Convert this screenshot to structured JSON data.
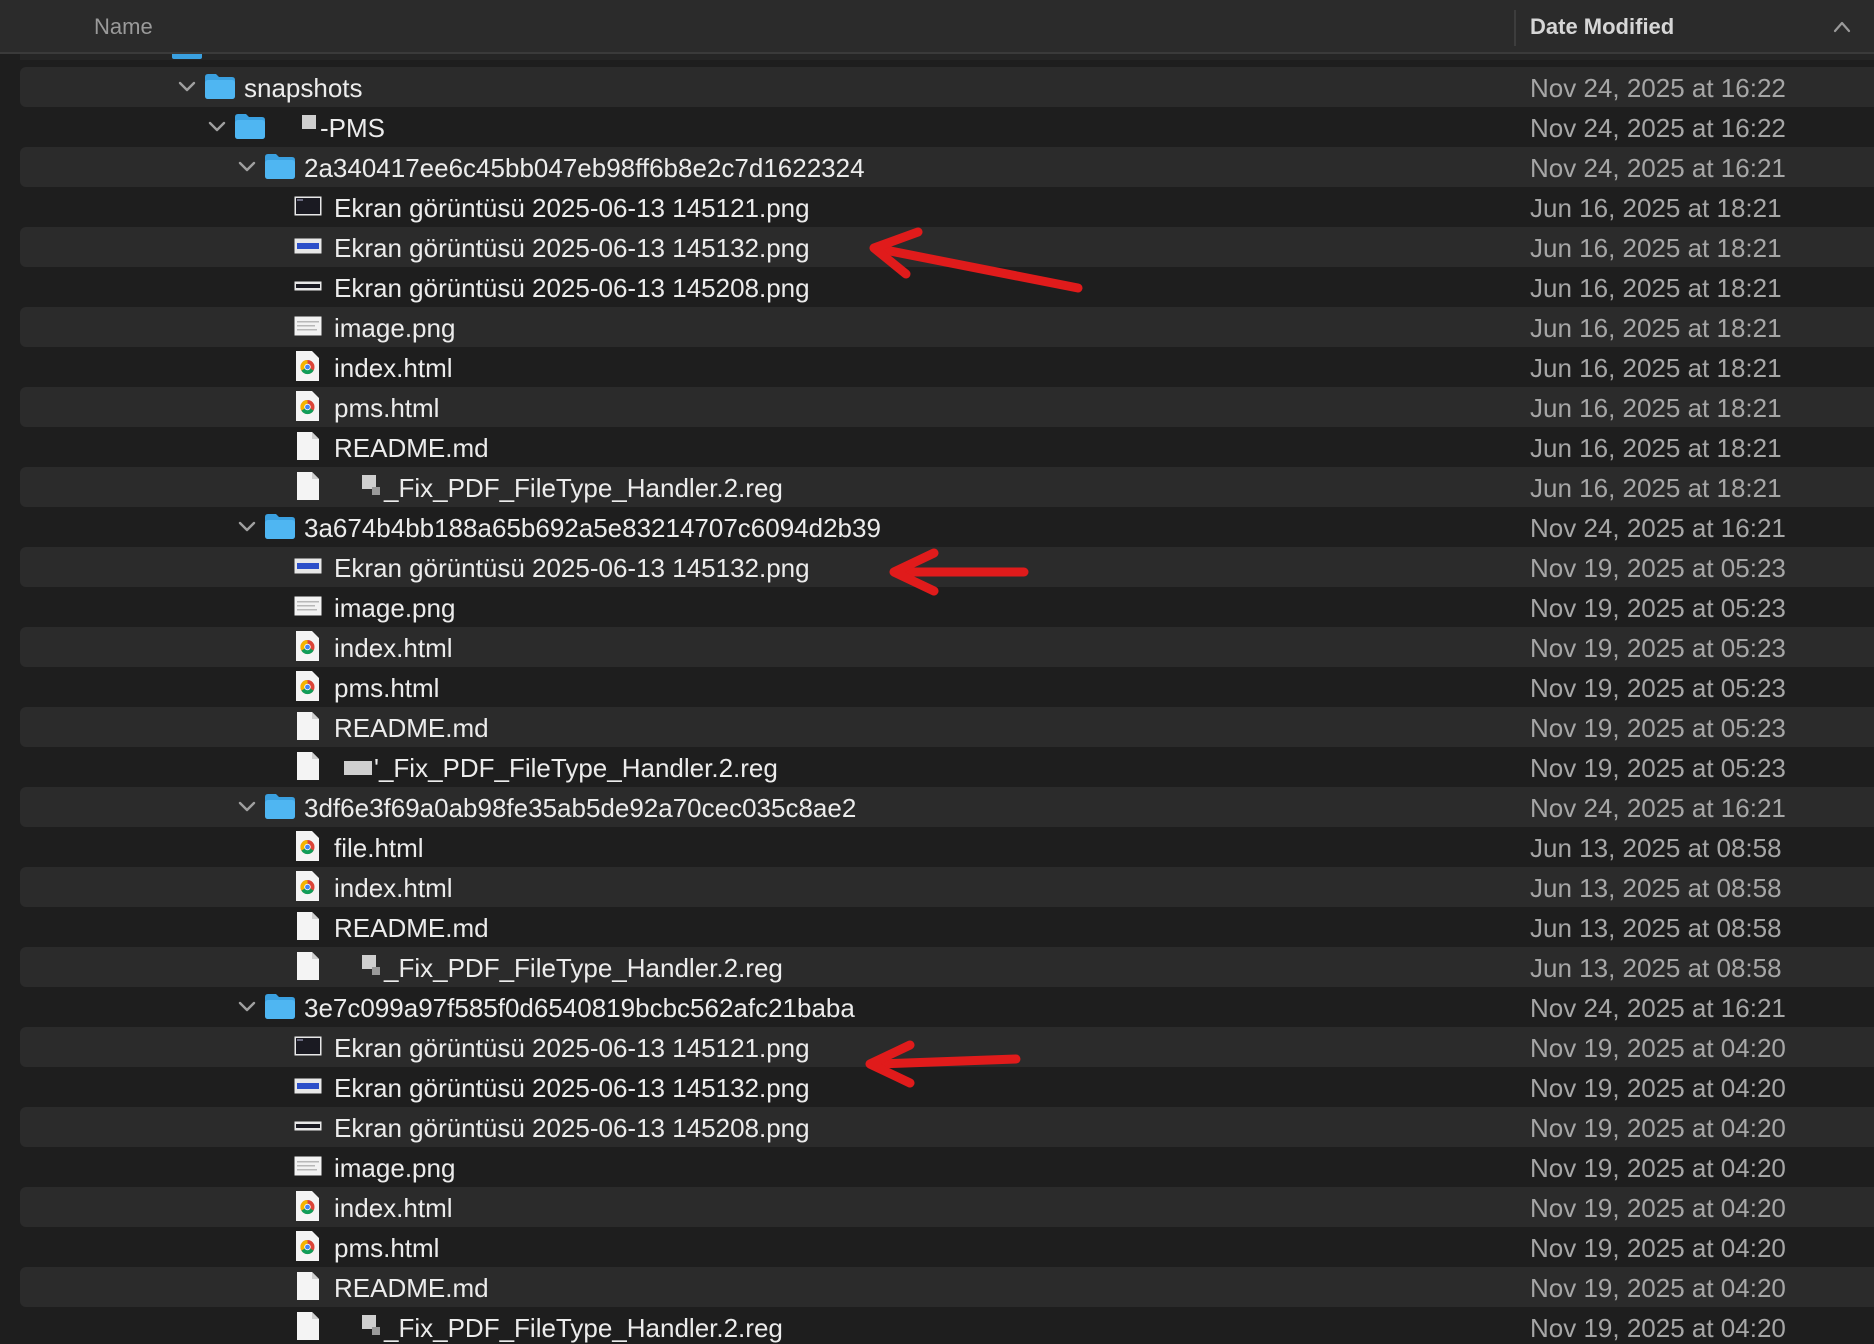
{
  "header": {
    "name_label": "Name",
    "date_label": "Date Modified"
  },
  "colors": {
    "background": "#1e1e1e",
    "row_alt": "#2b2b2b",
    "folder": "#3aa0e0",
    "annotation_arrow": "#e01b1b"
  },
  "rows": [
    {
      "name": "snapshots",
      "date": "Nov 24, 2025 at 16:22",
      "kind": "folder",
      "expanded": true
    },
    {
      "name": "-PMS",
      "date": "Nov 24, 2025 at 16:22",
      "kind": "folder",
      "expanded": true
    },
    {
      "name": "2a340417ee6c45bb047eb98ff6b8e2c7d1622324",
      "date": "Nov 24, 2025 at 16:21",
      "kind": "folder",
      "expanded": true
    },
    {
      "name": "Ekran görüntüsü 2025-06-13 145121.png",
      "date": "Jun 16, 2025 at 18:21",
      "kind": "png-screenshot"
    },
    {
      "name": "Ekran görüntüsü 2025-06-13 145132.png",
      "date": "Jun 16, 2025 at 18:21",
      "kind": "png-blue",
      "annotated": true
    },
    {
      "name": "Ekran görüntüsü 2025-06-13 145208.png",
      "date": "Jun 16, 2025 at 18:21",
      "kind": "png-wide"
    },
    {
      "name": "image.png",
      "date": "Jun 16, 2025 at 18:21",
      "kind": "png-image"
    },
    {
      "name": "index.html",
      "date": "Jun 16, 2025 at 18:21",
      "kind": "html"
    },
    {
      "name": "pms.html",
      "date": "Jun 16, 2025 at 18:21",
      "kind": "html"
    },
    {
      "name": "README.md",
      "date": "Jun 16, 2025 at 18:21",
      "kind": "document"
    },
    {
      "name": "_Fix_PDF_FileType_Handler.2.reg",
      "date": "Jun 16, 2025 at 18:21",
      "kind": "document"
    },
    {
      "name": "3a674b4bb188a65b692a5e83214707c6094d2b39",
      "date": "Nov 24, 2025 at 16:21",
      "kind": "folder",
      "expanded": true
    },
    {
      "name": "Ekran görüntüsü 2025-06-13 145132.png",
      "date": "Nov 19, 2025 at 05:23",
      "kind": "png-blue",
      "annotated": true
    },
    {
      "name": "image.png",
      "date": "Nov 19, 2025 at 05:23",
      "kind": "png-image"
    },
    {
      "name": "index.html",
      "date": "Nov 19, 2025 at 05:23",
      "kind": "html"
    },
    {
      "name": "pms.html",
      "date": "Nov 19, 2025 at 05:23",
      "kind": "html"
    },
    {
      "name": "README.md",
      "date": "Nov 19, 2025 at 05:23",
      "kind": "document"
    },
    {
      "name": "'_Fix_PDF_FileType_Handler.2.reg",
      "date": "Nov 19, 2025 at 05:23",
      "kind": "document"
    },
    {
      "name": "3df6e3f69a0ab98fe35ab5de92a70cec035c8ae2",
      "date": "Nov 24, 2025 at 16:21",
      "kind": "folder",
      "expanded": true
    },
    {
      "name": "file.html",
      "date": "Jun 13, 2025 at 08:58",
      "kind": "html"
    },
    {
      "name": "index.html",
      "date": "Jun 13, 2025 at 08:58",
      "kind": "html"
    },
    {
      "name": "README.md",
      "date": "Jun 13, 2025 at 08:58",
      "kind": "document"
    },
    {
      "name": "_Fix_PDF_FileType_Handler.2.reg",
      "date": "Jun 13, 2025 at 08:58",
      "kind": "document"
    },
    {
      "name": "3e7c099a97f585f0d6540819bcbc562afc21baba",
      "date": "Nov 24, 2025 at 16:21",
      "kind": "folder",
      "expanded": true
    },
    {
      "name": "Ekran görüntüsü 2025-06-13 145121.png",
      "date": "Nov 19, 2025 at 04:20",
      "kind": "png-screenshot",
      "annotated": true
    },
    {
      "name": "Ekran görüntüsü 2025-06-13 145132.png",
      "date": "Nov 19, 2025 at 04:20",
      "kind": "png-blue"
    },
    {
      "name": "Ekran görüntüsü 2025-06-13 145208.png",
      "date": "Nov 19, 2025 at 04:20",
      "kind": "png-wide"
    },
    {
      "name": "image.png",
      "date": "Nov 19, 2025 at 04:20",
      "kind": "png-image"
    },
    {
      "name": "index.html",
      "date": "Nov 19, 2025 at 04:20",
      "kind": "html"
    },
    {
      "name": "pms.html",
      "date": "Nov 19, 2025 at 04:20",
      "kind": "html"
    },
    {
      "name": "README.md",
      "date": "Nov 19, 2025 at 04:20",
      "kind": "document"
    },
    {
      "name": "_Fix_PDF_FileType_Handler.2.reg",
      "date": "Nov 19, 2025 at 04:20",
      "kind": "document"
    }
  ]
}
